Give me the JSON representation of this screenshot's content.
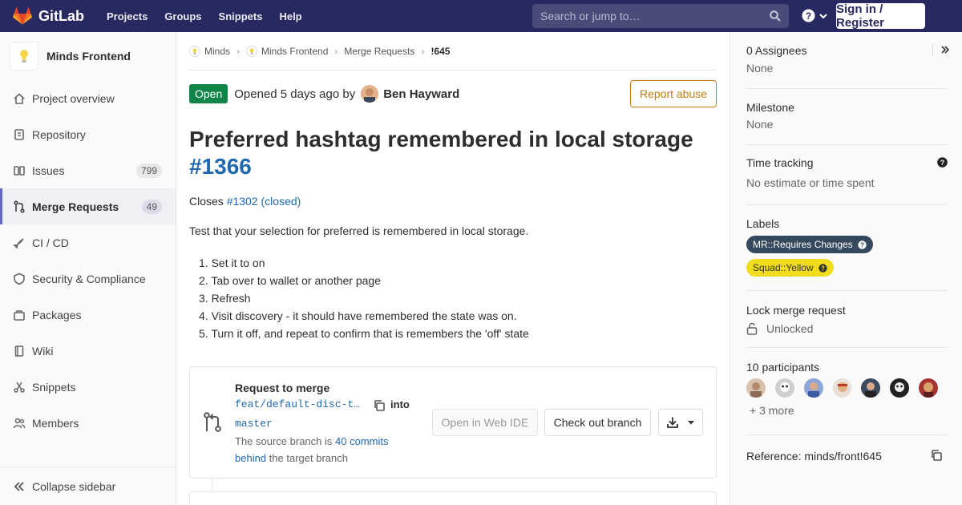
{
  "navbar": {
    "brand": "GitLab",
    "links": [
      "Projects",
      "Groups",
      "Snippets",
      "Help"
    ],
    "search_placeholder": "Search or jump to…",
    "signin_label": "Sign in / Register"
  },
  "sidebar": {
    "project_name": "Minds Frontend",
    "items": [
      {
        "label": "Project overview",
        "icon": "home-icon"
      },
      {
        "label": "Repository",
        "icon": "doc-icon"
      },
      {
        "label": "Issues",
        "icon": "issues-icon",
        "count": "799"
      },
      {
        "label": "Merge Requests",
        "icon": "merge-request-icon",
        "count": "49",
        "active": true
      },
      {
        "label": "CI / CD",
        "icon": "rocket-icon"
      },
      {
        "label": "Security & Compliance",
        "icon": "shield-icon"
      },
      {
        "label": "Packages",
        "icon": "package-icon"
      },
      {
        "label": "Wiki",
        "icon": "book-icon"
      },
      {
        "label": "Snippets",
        "icon": "scissors-icon"
      },
      {
        "label": "Members",
        "icon": "users-icon"
      }
    ],
    "collapse_label": "Collapse sidebar"
  },
  "breadcrumbs": [
    "Minds",
    "Minds Frontend",
    "Merge Requests",
    "!645"
  ],
  "mr": {
    "status": "Open",
    "opened_text": "Opened 5 days ago by",
    "author": "Ben Hayward",
    "report_label": "Report abuse",
    "title": "Preferred hashtag remembered in local storage",
    "title_ref": "#1366",
    "closes_prefix": "Closes",
    "closes_link": "#1302 (closed)",
    "description": "Test that your selection for preferred is remembered in local storage.",
    "steps": [
      "1. Set it to on",
      "2. Tab over to wallet or another page",
      "3. Refresh",
      "4. Visit discovery - it should have remembered the state was on.",
      "5. Turn it off, and repeat to confirm that is remembers the 'off' state"
    ]
  },
  "merge_widget": {
    "title": "Request to merge",
    "source_branch": "feat/default-disc-t…",
    "into_label": "into",
    "target_branch": "master",
    "behind_prefix": "The source branch is",
    "behind_link": "40 commits behind",
    "behind_suffix": "the target branch",
    "ide_label": "Open in Web IDE",
    "checkout_label": "Check out branch"
  },
  "right_sidebar": {
    "assignees_title": "0 Assignees",
    "assignees_value": "None",
    "milestone_title": "Milestone",
    "milestone_value": "None",
    "time_title": "Time tracking",
    "time_value": "No estimate or time spent",
    "labels_title": "Labels",
    "labels": [
      {
        "text": "MR::Requires Changes",
        "color": "#34495e"
      },
      {
        "text": "Squad::Yellow",
        "color": "#f1dc1d"
      }
    ],
    "lock_title": "Lock merge request",
    "lock_value": "Unlocked",
    "participants_title": "10 participants",
    "participants_more": "+ 3 more",
    "reference": "Reference: minds/front!645"
  },
  "colors": {
    "navbar": "#292961",
    "open_badge": "#108548",
    "link": "#1f69b0",
    "report": "#c17d10"
  }
}
